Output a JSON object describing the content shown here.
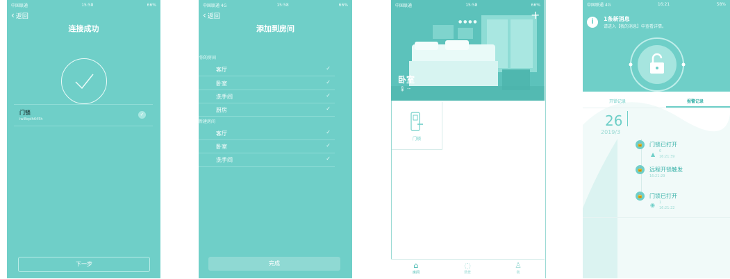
{
  "screen1": {
    "status": {
      "carrier": "中国联通",
      "time": "15:58",
      "battery": "66%"
    },
    "back_label": "返回",
    "title": "连接成功",
    "device": {
      "name": "门锁",
      "id": "iwl8eplh645h"
    },
    "next_button": "下一步"
  },
  "screen2": {
    "status": {
      "carrier": "中国联通 4G",
      "time": "15:58",
      "battery": "66%"
    },
    "back_label": "返回",
    "title": "添加到房间",
    "your_rooms_label": "你的房间",
    "your_rooms": [
      "客厅",
      "卧室",
      "洗手间",
      "厨房"
    ],
    "new_rooms_label": "新建房间",
    "new_rooms": [
      "客厅",
      "卧室",
      "洗手间"
    ],
    "done_button": "完成"
  },
  "screen3": {
    "status": {
      "carrier": "中国联通",
      "time": "15:58",
      "battery": "66%"
    },
    "room_name": "卧室",
    "device_label": "门锁",
    "tabs": [
      {
        "label": "房间",
        "icon": "home-icon"
      },
      {
        "label": "场景",
        "icon": "scene-icon"
      },
      {
        "label": "我",
        "icon": "profile-icon"
      }
    ]
  },
  "screen4": {
    "status": {
      "carrier": "中国联通 4G",
      "time": "16:21",
      "battery": "58%"
    },
    "notice_title": "1条新消息",
    "notice_body": "请进入【我的消息】中查看详情。",
    "tabs": [
      "开锁记录",
      "报警记录"
    ],
    "date_day": "26",
    "date_month": "2019/3",
    "events": [
      {
        "title": "门锁已打开",
        "sub": "0",
        "time": "16:21:39"
      },
      {
        "title": "远程开锁触发",
        "sub": "",
        "time": "16:21:29"
      },
      {
        "title": "门锁已打开",
        "sub": "1",
        "time": "16:21:22"
      }
    ]
  },
  "colors": {
    "teal": "#6fcfc8",
    "teal_dark": "#5cc2bb",
    "accent": "#2fb8ad"
  }
}
